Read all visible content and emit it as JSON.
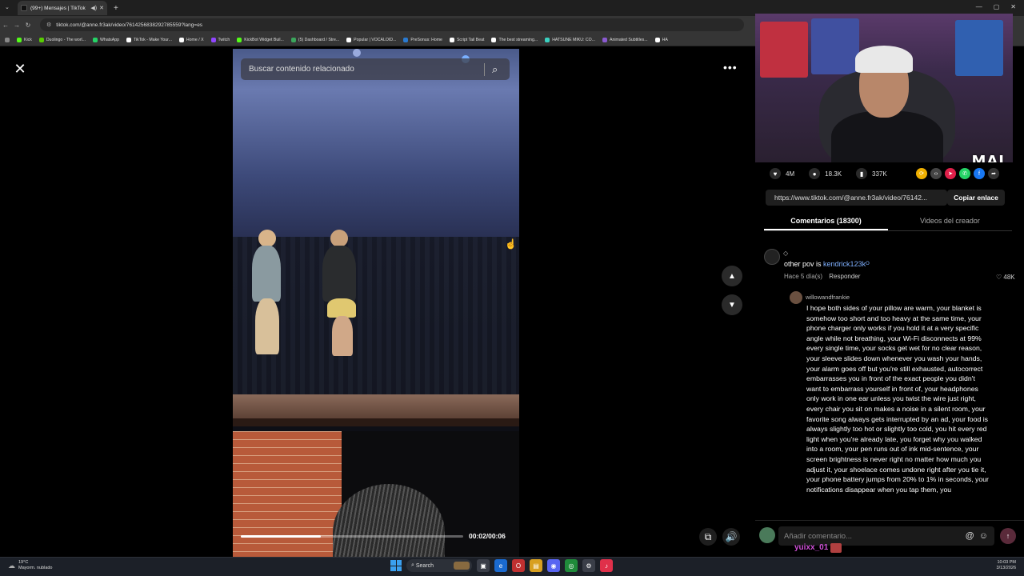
{
  "browser": {
    "tab_title": "(99+) Mensajes | TikTok",
    "url": "tiktok.com/@anne.fr3ak/video/7614256838292785559?lang=es",
    "bookmarks": [
      {
        "label": "Kick",
        "color": "#53fc18"
      },
      {
        "label": "Duolingo - The worl...",
        "color": "#58cc02"
      },
      {
        "label": "WhatsApp",
        "color": "#25d366"
      },
      {
        "label": "TikTok - Make Your...",
        "color": "#ffffff"
      },
      {
        "label": "Home / X",
        "color": "#ffffff"
      },
      {
        "label": "Twitch",
        "color": "#9146ff"
      },
      {
        "label": "KickBot Widget Buil...",
        "color": "#53fc18"
      },
      {
        "label": "(5) Dashboard / Stre...",
        "color": "#3ba55c"
      },
      {
        "label": "Popular | VOCALOID...",
        "color": "#ffffff"
      },
      {
        "label": "PreSonus: Home",
        "color": "#2a7ad0"
      },
      {
        "label": "Script Tail Beat",
        "color": "#ffffff"
      },
      {
        "label": "The best streaming...",
        "color": "#ffffff"
      },
      {
        "label": "HATSUNE MIKU: CO...",
        "color": "#3ad0c0"
      },
      {
        "label": "Animated Subtitles...",
        "color": "#8a5ad0"
      },
      {
        "label": "HA",
        "color": "#ffffff"
      }
    ]
  },
  "search": {
    "placeholder": "Buscar contenido relacionado"
  },
  "video": {
    "time": "00:02/00:06",
    "progress_fraction": 0.36
  },
  "webcam": {
    "overlay_text": "MAI"
  },
  "stats": {
    "likes": "4M",
    "comments": "18.3K",
    "saves": "337K"
  },
  "share": {
    "colors": [
      "#f0b000",
      "#444444",
      "#e0204a",
      "#25d366",
      "#1877f2",
      "#333333"
    ],
    "link": "https://www.tiktok.com/@anne.fr3ak/video/76142...",
    "copy_label": "Copiar enlace"
  },
  "tabs": {
    "comments": "Comentarios (18300)",
    "creator": "Videos del creador"
  },
  "comment1": {
    "user": "◇",
    "text_prefix": "other pov is",
    "mention": "kendrick123k",
    "mention_suffix": "ᴼ",
    "time": "Hace 5 día(s)",
    "reply": "Responder",
    "likes": "48K"
  },
  "comment2": {
    "user": "willowandfrankie",
    "text": "I hope both sides of your pillow are warm, your blanket is somehow too short and too heavy at the same time, your phone charger only works if you hold it at a very specific angle while not breathing, your Wi-Fi disconnects at 99% every single time, your socks get wet for no clear reason, your sleeve slides down whenever you wash your hands, your alarm goes off but you're still exhausted, autocorrect embarrasses you in front of the exact people you didn't want to embarrass yourself in front of, your headphones only work in one ear unless you twist the wire just right, every chair you sit on makes a noise in a silent room, your favorite song always gets interrupted by an ad, your food is always slightly too hot or slightly too cold, you hit every red light when you're already late, you forget why you walked into a room, your pen runs out of ink mid-sentence, your screen brightness is never right no matter how much you adjust it, your shoelace comes undone right after you tie it, your phone battery jumps from 20% to 1% in seconds, your notifications disappear when you tap them, you"
  },
  "comment_input": {
    "placeholder": "Añadir comentario..."
  },
  "overlay": {
    "name": "yuixx_01"
  },
  "taskbar": {
    "temp": "19°C",
    "condition": "Mayorm. nublado",
    "search": "Search",
    "time": "10:03 PM",
    "date": "3/13/2026"
  }
}
